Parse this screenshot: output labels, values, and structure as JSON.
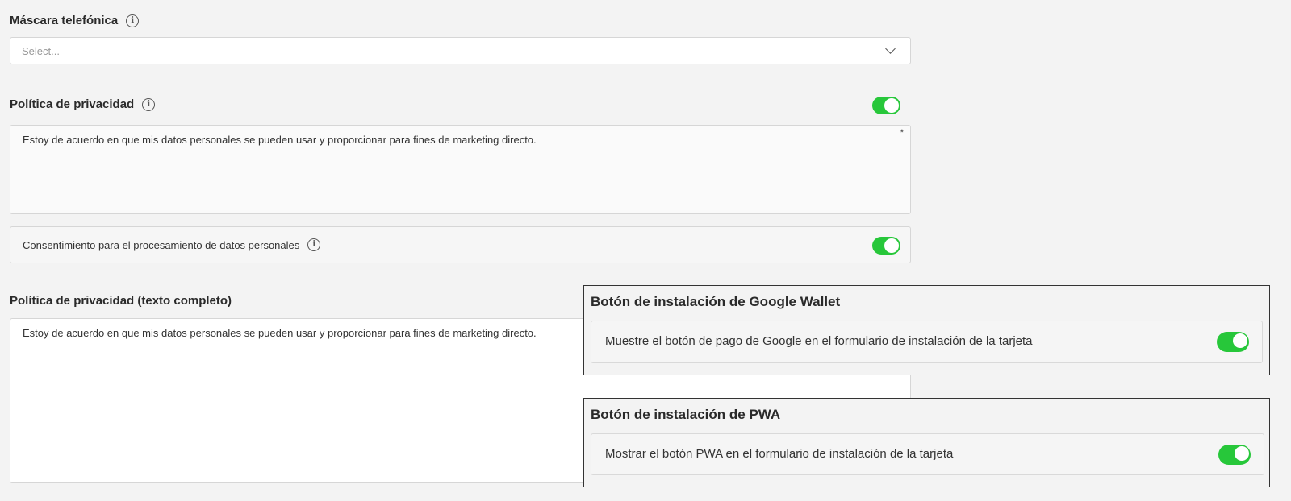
{
  "phone_mask": {
    "label": "Máscara telefónica",
    "select_placeholder": "Select..."
  },
  "privacy_policy": {
    "label": "Política de privacidad",
    "toggle_on": true,
    "text": "Estoy de acuerdo en que mis datos personales se pueden usar y proporcionar para fines de marketing directo.",
    "required_mark": "*"
  },
  "consent": {
    "label": "Consentimiento para el procesamiento de datos personales",
    "toggle_on": true
  },
  "privacy_full": {
    "label": "Política de privacidad (texto completo)",
    "text": "Estoy de acuerdo en que mis datos personales se pueden usar y proporcionar para fines de marketing directo."
  },
  "google_wallet": {
    "title": "Botón de instalación de Google Wallet",
    "option": "Muestre el botón de pago de Google en el formulario de instalación de la tarjeta",
    "toggle_on": true
  },
  "pwa": {
    "title": "Botón de instalación de PWA",
    "option": "Mostrar el botón PWA en el formulario de instalación de la tarjeta",
    "toggle_on": true
  },
  "icons": {
    "info": "info-icon",
    "dropdown": "chevron-down-icon"
  },
  "colors": {
    "toggle_on": "#27c73a",
    "page_bg": "#f3f3f3"
  }
}
